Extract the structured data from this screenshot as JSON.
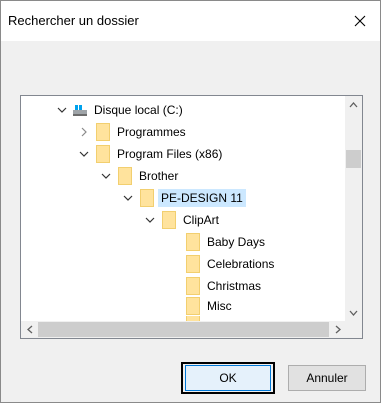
{
  "dialog": {
    "title": "Rechercher un dossier",
    "close_icon": "close-icon"
  },
  "tree": {
    "items": [
      {
        "label": "Disque local (C:)",
        "icon": "drive-icon",
        "chevron": "expanded"
      },
      {
        "label": "Programmes",
        "icon": "folder-icon",
        "chevron": "collapsed"
      },
      {
        "label": "Program Files (x86)",
        "icon": "folder-icon",
        "chevron": "expanded"
      },
      {
        "label": "Brother",
        "icon": "folder-icon",
        "chevron": "expanded"
      },
      {
        "label": "PE-DESIGN 11",
        "icon": "folder-icon",
        "chevron": "expanded",
        "selected": true
      },
      {
        "label": "ClipArt",
        "icon": "folder-icon",
        "chevron": "expanded"
      },
      {
        "label": "Baby Days",
        "icon": "folder-icon",
        "chevron": "none"
      },
      {
        "label": "Celebrations",
        "icon": "folder-icon",
        "chevron": "none"
      },
      {
        "label": "Christmas",
        "icon": "folder-icon",
        "chevron": "none"
      },
      {
        "label": "Misc",
        "icon": "folder-icon",
        "chevron": "none"
      }
    ]
  },
  "buttons": {
    "ok": "OK",
    "cancel": "Annuler"
  },
  "colors": {
    "selection": "#cce8ff",
    "folder": "#ffe39d",
    "focus_border": "#0078d7"
  }
}
